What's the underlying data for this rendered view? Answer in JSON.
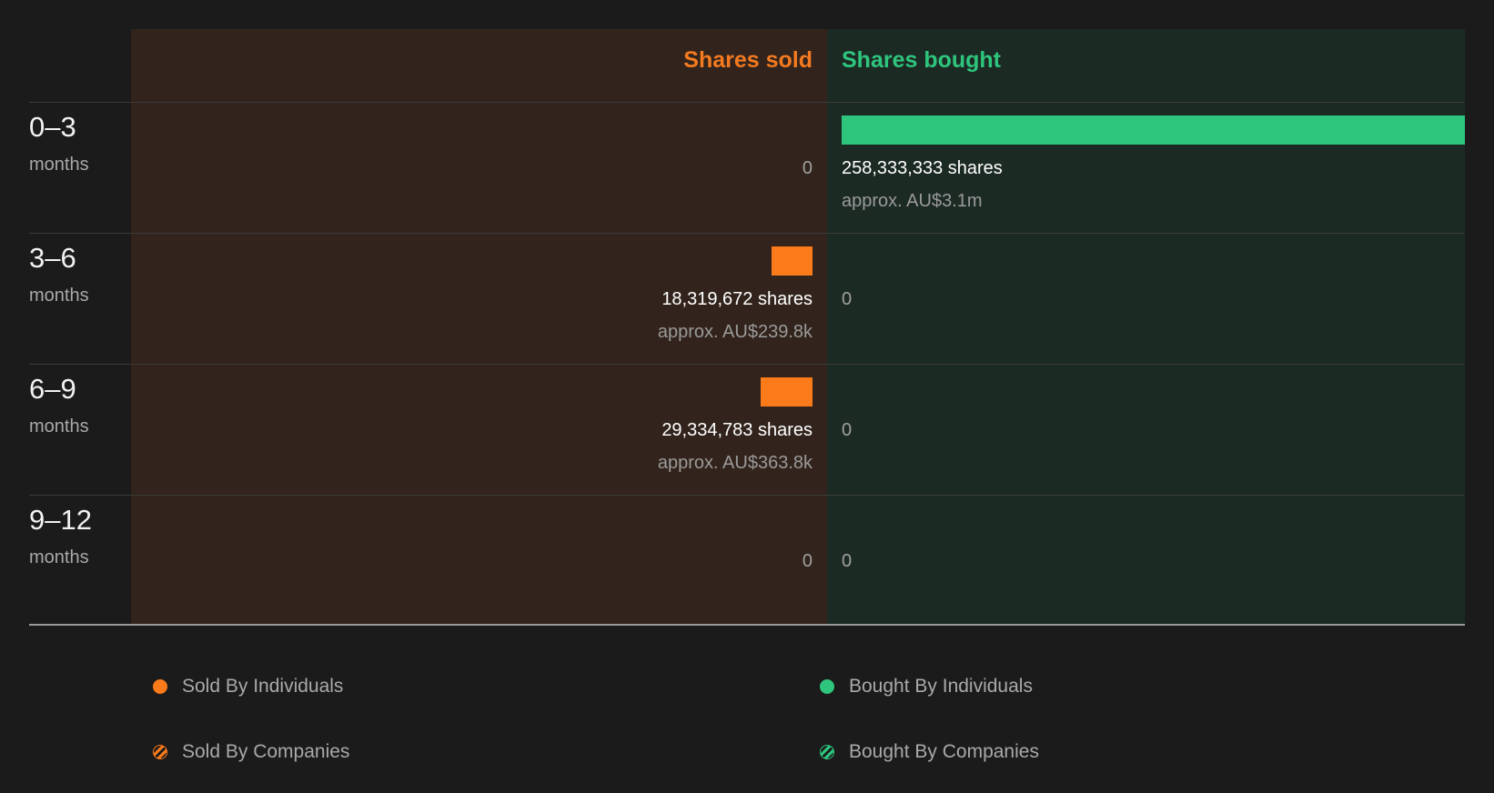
{
  "colors": {
    "sold": "#fb7b1b",
    "bought": "#2ec57d",
    "sold_background": "#32241c",
    "bought_background": "#1c2a24"
  },
  "chart_data": {
    "type": "bar",
    "headers": {
      "sold": "Shares sold",
      "bought": "Shares bought"
    },
    "rows": [
      {
        "period": "0–3",
        "unit": "months",
        "sold": 0,
        "sold_label": "0",
        "sold_value": "",
        "bought": 258333333,
        "bought_label": "258,333,333 shares",
        "bought_value": "approx. AU$3.1m"
      },
      {
        "period": "3–6",
        "unit": "months",
        "sold": 18319672,
        "sold_label": "18,319,672 shares",
        "sold_value": "approx. AU$239.8k",
        "bought": 0,
        "bought_label": "0",
        "bought_value": ""
      },
      {
        "period": "6–9",
        "unit": "months",
        "sold": 29334783,
        "sold_label": "29,334,783 shares",
        "sold_value": "approx. AU$363.8k",
        "bought": 0,
        "bought_label": "0",
        "bought_value": ""
      },
      {
        "period": "9–12",
        "unit": "months",
        "sold": 0,
        "sold_label": "0",
        "sold_value": "",
        "bought": 0,
        "bought_label": "0",
        "bought_value": ""
      }
    ],
    "legend": [
      {
        "label": "Sold By Individuals",
        "pattern": "solid",
        "color": "#fb7b1b"
      },
      {
        "label": "Bought By Individuals",
        "pattern": "solid",
        "color": "#2ec57d"
      },
      {
        "label": "Sold By Companies",
        "pattern": "striped",
        "color": "#fb7b1b"
      },
      {
        "label": "Bought By Companies",
        "pattern": "striped",
        "color": "#2ec57d"
      }
    ]
  }
}
